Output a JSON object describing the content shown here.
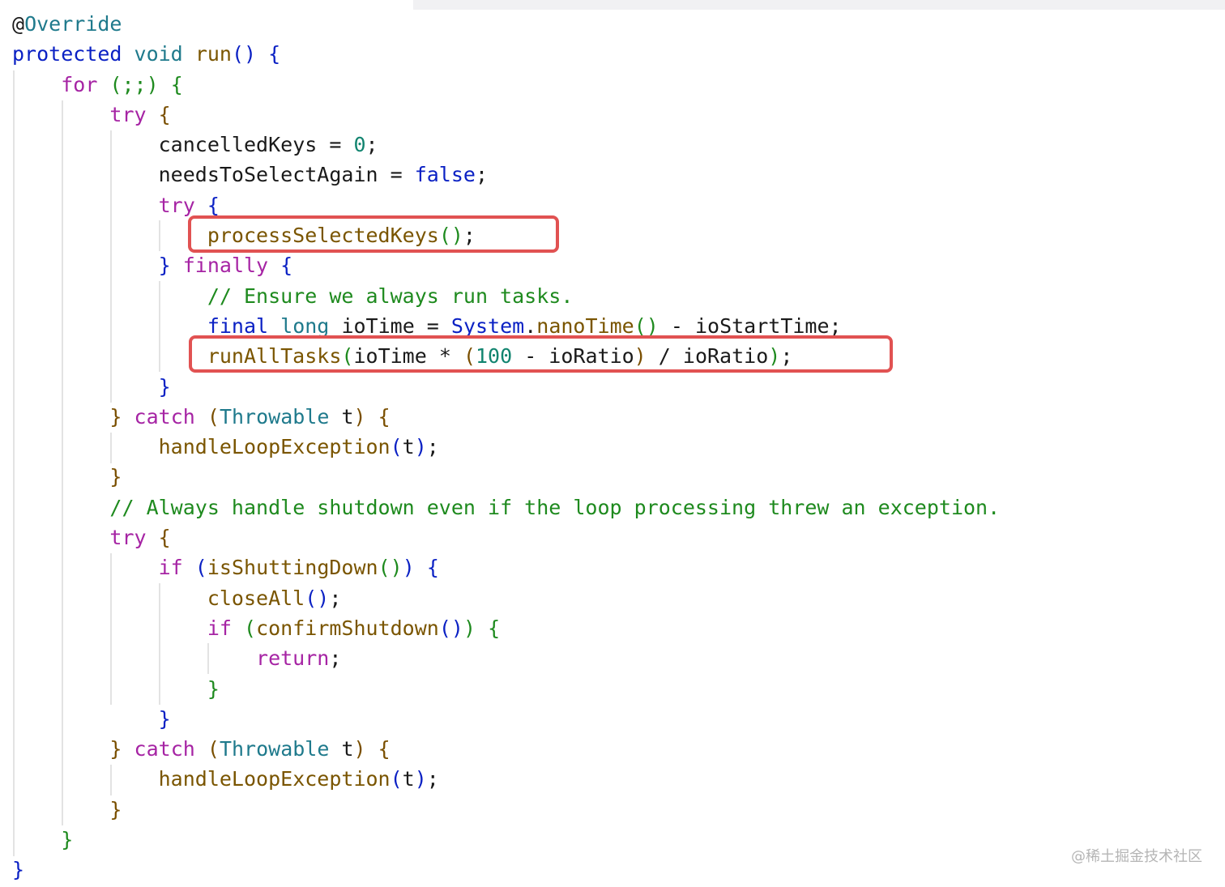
{
  "code": {
    "lines": [
      [
        {
          "t": "@",
          "c": "t-txt"
        },
        {
          "t": "Override",
          "c": "t-type"
        }
      ],
      [
        {
          "t": "protected",
          "c": "t-kw"
        },
        {
          "t": " "
        },
        {
          "t": "void",
          "c": "t-type"
        },
        {
          "t": " "
        },
        {
          "t": "run",
          "c": "t-fn"
        },
        {
          "t": "()",
          "c": "t-br1"
        },
        {
          "t": " "
        },
        {
          "t": "{",
          "c": "t-br1"
        }
      ],
      [
        {
          "t": "    "
        },
        {
          "t": "for",
          "c": "t-kw2"
        },
        {
          "t": " "
        },
        {
          "t": "(;;)",
          "c": "t-br2"
        },
        {
          "t": " "
        },
        {
          "t": "{",
          "c": "t-br2"
        }
      ],
      [
        {
          "t": "        "
        },
        {
          "t": "try",
          "c": "t-kw2"
        },
        {
          "t": " "
        },
        {
          "t": "{",
          "c": "t-br3"
        }
      ],
      [
        {
          "t": "            "
        },
        {
          "t": "cancelledKeys = ",
          "c": "t-txt"
        },
        {
          "t": "0",
          "c": "t-num"
        },
        {
          "t": ";",
          "c": "t-txt"
        }
      ],
      [
        {
          "t": "            "
        },
        {
          "t": "needsToSelectAgain = ",
          "c": "t-txt"
        },
        {
          "t": "false",
          "c": "t-kw"
        },
        {
          "t": ";",
          "c": "t-txt"
        }
      ],
      [
        {
          "t": "            "
        },
        {
          "t": "try",
          "c": "t-kw2"
        },
        {
          "t": " "
        },
        {
          "t": "{",
          "c": "t-br1"
        }
      ],
      [
        {
          "t": "                "
        },
        {
          "t": "processSelectedKeys",
          "c": "t-fn"
        },
        {
          "t": "()",
          "c": "t-br2"
        },
        {
          "t": ";",
          "c": "t-txt"
        }
      ],
      [
        {
          "t": "            "
        },
        {
          "t": "}",
          "c": "t-br1"
        },
        {
          "t": " "
        },
        {
          "t": "finally",
          "c": "t-kw2"
        },
        {
          "t": " "
        },
        {
          "t": "{",
          "c": "t-br1"
        }
      ],
      [
        {
          "t": "                "
        },
        {
          "t": "// Ensure we always run tasks.",
          "c": "t-com"
        }
      ],
      [
        {
          "t": "                "
        },
        {
          "t": "final",
          "c": "t-kw"
        },
        {
          "t": " "
        },
        {
          "t": "long",
          "c": "t-type"
        },
        {
          "t": " "
        },
        {
          "t": "ioTime = ",
          "c": "t-txt"
        },
        {
          "t": "System",
          "c": "t-sys"
        },
        {
          "t": ".",
          "c": "t-txt"
        },
        {
          "t": "nanoTime",
          "c": "t-fn"
        },
        {
          "t": "()",
          "c": "t-br2"
        },
        {
          "t": " - ioStartTime;",
          "c": "t-txt"
        }
      ],
      [
        {
          "t": "                "
        },
        {
          "t": "runAllTasks",
          "c": "t-fn"
        },
        {
          "t": "(",
          "c": "t-br2"
        },
        {
          "t": "ioTime * ",
          "c": "t-txt"
        },
        {
          "t": "(",
          "c": "t-br3"
        },
        {
          "t": "100",
          "c": "t-num"
        },
        {
          "t": " - ioRatio",
          "c": "t-txt"
        },
        {
          "t": ")",
          "c": "t-br3"
        },
        {
          "t": " / ioRatio",
          "c": "t-txt"
        },
        {
          "t": ")",
          "c": "t-br2"
        },
        {
          "t": ";",
          "c": "t-txt"
        }
      ],
      [
        {
          "t": "            "
        },
        {
          "t": "}",
          "c": "t-br1"
        }
      ],
      [
        {
          "t": "        "
        },
        {
          "t": "}",
          "c": "t-br3"
        },
        {
          "t": " "
        },
        {
          "t": "catch",
          "c": "t-kw2"
        },
        {
          "t": " "
        },
        {
          "t": "(",
          "c": "t-br3"
        },
        {
          "t": "Throwable",
          "c": "t-type"
        },
        {
          "t": " t",
          "c": "t-txt"
        },
        {
          "t": ")",
          "c": "t-br3"
        },
        {
          "t": " "
        },
        {
          "t": "{",
          "c": "t-br3"
        }
      ],
      [
        {
          "t": "            "
        },
        {
          "t": "handleLoopException",
          "c": "t-fn"
        },
        {
          "t": "(",
          "c": "t-br1"
        },
        {
          "t": "t",
          "c": "t-txt"
        },
        {
          "t": ")",
          "c": "t-br1"
        },
        {
          "t": ";",
          "c": "t-txt"
        }
      ],
      [
        {
          "t": "        "
        },
        {
          "t": "}",
          "c": "t-br3"
        }
      ],
      [
        {
          "t": "        "
        },
        {
          "t": "// Always handle shutdown even if the loop processing threw an exception.",
          "c": "t-com"
        }
      ],
      [
        {
          "t": "        "
        },
        {
          "t": "try",
          "c": "t-kw2"
        },
        {
          "t": " "
        },
        {
          "t": "{",
          "c": "t-br3"
        }
      ],
      [
        {
          "t": "            "
        },
        {
          "t": "if",
          "c": "t-kw2"
        },
        {
          "t": " "
        },
        {
          "t": "(",
          "c": "t-br1"
        },
        {
          "t": "isShuttingDown",
          "c": "t-fn"
        },
        {
          "t": "()",
          "c": "t-br2"
        },
        {
          "t": ")",
          "c": "t-br1"
        },
        {
          "t": " "
        },
        {
          "t": "{",
          "c": "t-br1"
        }
      ],
      [
        {
          "t": "                "
        },
        {
          "t": "closeAll",
          "c": "t-fn"
        },
        {
          "t": "()",
          "c": "t-br1"
        },
        {
          "t": ";",
          "c": "t-txt"
        }
      ],
      [
        {
          "t": "                "
        },
        {
          "t": "if",
          "c": "t-kw2"
        },
        {
          "t": " "
        },
        {
          "t": "(",
          "c": "t-br2"
        },
        {
          "t": "confirmShutdown",
          "c": "t-fn"
        },
        {
          "t": "()",
          "c": "t-br1"
        },
        {
          "t": ")",
          "c": "t-br2"
        },
        {
          "t": " "
        },
        {
          "t": "{",
          "c": "t-br2"
        }
      ],
      [
        {
          "t": "                    "
        },
        {
          "t": "return",
          "c": "t-kw2"
        },
        {
          "t": ";",
          "c": "t-txt"
        }
      ],
      [
        {
          "t": "                "
        },
        {
          "t": "}",
          "c": "t-br2"
        }
      ],
      [
        {
          "t": "            "
        },
        {
          "t": "}",
          "c": "t-br1"
        }
      ],
      [
        {
          "t": "        "
        },
        {
          "t": "}",
          "c": "t-br3"
        },
        {
          "t": " "
        },
        {
          "t": "catch",
          "c": "t-kw2"
        },
        {
          "t": " "
        },
        {
          "t": "(",
          "c": "t-br3"
        },
        {
          "t": "Throwable",
          "c": "t-type"
        },
        {
          "t": " t",
          "c": "t-txt"
        },
        {
          "t": ")",
          "c": "t-br3"
        },
        {
          "t": " "
        },
        {
          "t": "{",
          "c": "t-br3"
        }
      ],
      [
        {
          "t": "            "
        },
        {
          "t": "handleLoopException",
          "c": "t-fn"
        },
        {
          "t": "(",
          "c": "t-br1"
        },
        {
          "t": "t",
          "c": "t-txt"
        },
        {
          "t": ")",
          "c": "t-br1"
        },
        {
          "t": ";",
          "c": "t-txt"
        }
      ],
      [
        {
          "t": "        "
        },
        {
          "t": "}",
          "c": "t-br3"
        }
      ],
      [
        {
          "t": "    "
        },
        {
          "t": "}",
          "c": "t-br2"
        }
      ],
      [
        {
          "t": "}",
          "c": "t-br1"
        }
      ]
    ]
  },
  "highlights": {
    "process_label": "processSelectedKeys call",
    "runall_label": "runAllTasks call",
    "color": "#e15252"
  },
  "watermark": "@稀土掘金技术社区"
}
